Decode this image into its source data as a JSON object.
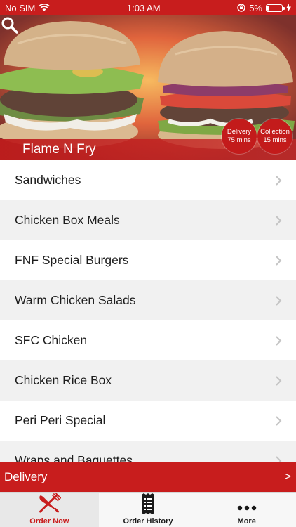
{
  "status_bar": {
    "carrier": "No SIM",
    "time": "1:03 AM",
    "battery": "5%",
    "battery_level": 0.05
  },
  "restaurant": {
    "name": "Flame N Fry"
  },
  "badges": {
    "delivery": {
      "label": "Delivery",
      "time": "75 mins"
    },
    "collection": {
      "label": "Collection",
      "time": "15 mins"
    }
  },
  "menu": {
    "items": [
      "Sandwiches",
      "Chicken Box Meals",
      "FNF Special Burgers",
      "Warm Chicken Salads",
      "SFC Chicken",
      "Chicken Rice Box",
      "Peri Peri Special",
      "Wraps and Baguettes"
    ]
  },
  "order_bar": {
    "label": "Delivery",
    "arrow": ">"
  },
  "tabs": [
    {
      "label": "Order Now",
      "icon": "fork-knife-icon"
    },
    {
      "label": "Order History",
      "icon": "receipt-icon"
    },
    {
      "label": "More",
      "icon": "more-dots-icon"
    }
  ],
  "colors": {
    "brand": "#c81d1d",
    "tab_bg": "#f7f7f7",
    "row_alt": "#f1f1f1"
  }
}
